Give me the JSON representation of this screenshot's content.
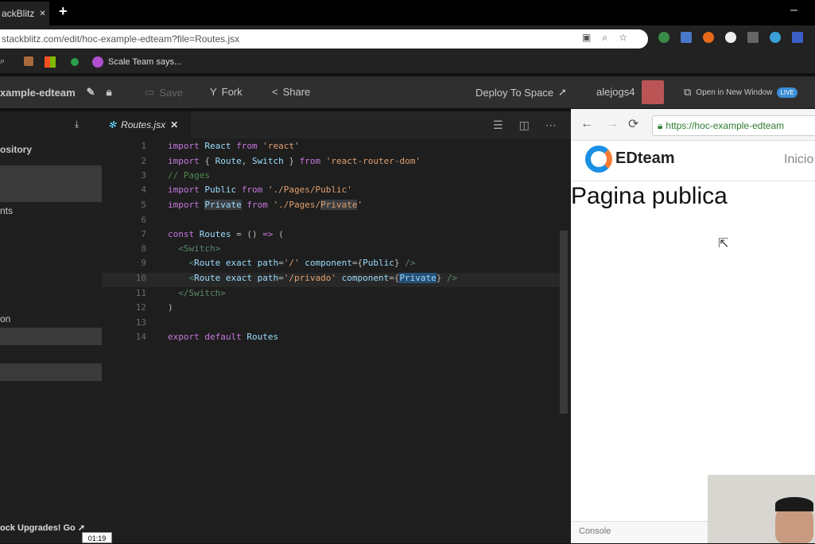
{
  "browser": {
    "tab_title": "ackBlitz",
    "tab_close": "✕",
    "new_tab": "+",
    "url": "stackblitz.com/edit/hoc-example-edteam?file=Routes.jsx",
    "window_min": "–"
  },
  "bookmarks": [
    {
      "label": "Scale Team says..."
    }
  ],
  "header": {
    "project": "xample-edteam",
    "save": "Save",
    "fork": "Fork",
    "share": "Share",
    "deploy": "Deploy To Space",
    "user": "alejogs4",
    "open_window": "Open in New Window",
    "live": "LIVE"
  },
  "sidebar": {
    "items": [
      {
        "label": "ository"
      },
      {
        "label": "nts"
      },
      {
        "label": "on"
      }
    ],
    "upgrade": "ock Upgrades! Go"
  },
  "editor": {
    "tab": "Routes.jsx",
    "tab_close": "✕",
    "lines": [
      {
        "n": "1",
        "text": "import React from 'react'"
      },
      {
        "n": "2",
        "text": "import { Route, Switch } from 'react-router-dom'"
      },
      {
        "n": "3",
        "text": "// Pages"
      },
      {
        "n": "4",
        "text": "import Public from './Pages/Public'"
      },
      {
        "n": "5",
        "text": "import Private from './Pages/Private'"
      },
      {
        "n": "6",
        "text": ""
      },
      {
        "n": "7",
        "text": "const Routes = () => ("
      },
      {
        "n": "8",
        "text": "  <Switch>"
      },
      {
        "n": "9",
        "text": "    <Route exact path='/' component={Public} />"
      },
      {
        "n": "10",
        "text": "    <Route exact path='/privado' component={Private} />"
      },
      {
        "n": "11",
        "text": "  </Switch>"
      },
      {
        "n": "12",
        "text": ")"
      },
      {
        "n": "13",
        "text": ""
      },
      {
        "n": "14",
        "text": "export default Routes"
      }
    ]
  },
  "preview": {
    "url": "https://hoc-example-edteam",
    "brand": "EDteam",
    "nav": "Inicio",
    "heading": "Pagina publica",
    "console": "Console"
  },
  "video": {
    "timer": "01:19"
  }
}
